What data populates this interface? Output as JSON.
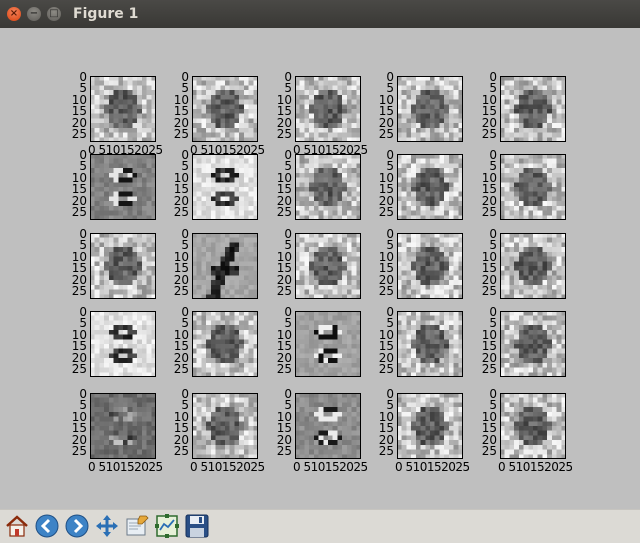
{
  "window": {
    "title": "Figure 1"
  },
  "axes": {
    "y_ticks": [
      "0",
      "5",
      "10",
      "15",
      "20",
      "25"
    ],
    "x_tick_text": "0 510152025"
  },
  "grid": {
    "rows": 5,
    "cols": 5,
    "tiles": [
      "mean",
      "mean",
      "mean",
      "mean",
      "mean",
      "digit8-dark",
      "digit8-light",
      "mean",
      "mean",
      "mean",
      "mean",
      "digit4",
      "mean",
      "mean",
      "mean",
      "digit8-light",
      "mean",
      "digit5",
      "mean",
      "mean",
      "digit-dark-gray",
      "mean",
      "digit-gray",
      "mean",
      "mean"
    ]
  },
  "toolbar": {
    "buttons": [
      {
        "name": "home",
        "icon": "home-icon"
      },
      {
        "name": "back",
        "icon": "back-arrow-icon"
      },
      {
        "name": "forward",
        "icon": "forward-arrow-icon"
      },
      {
        "name": "pan",
        "icon": "move-icon"
      },
      {
        "name": "zoom",
        "icon": "zoom-rect-icon"
      },
      {
        "name": "subplots",
        "icon": "subplots-icon"
      },
      {
        "name": "save",
        "icon": "save-icon"
      }
    ]
  },
  "colors": {
    "figure_bg": "#bfbfbf",
    "titlebar": "#3c3b37",
    "close_button": "#e95420"
  }
}
